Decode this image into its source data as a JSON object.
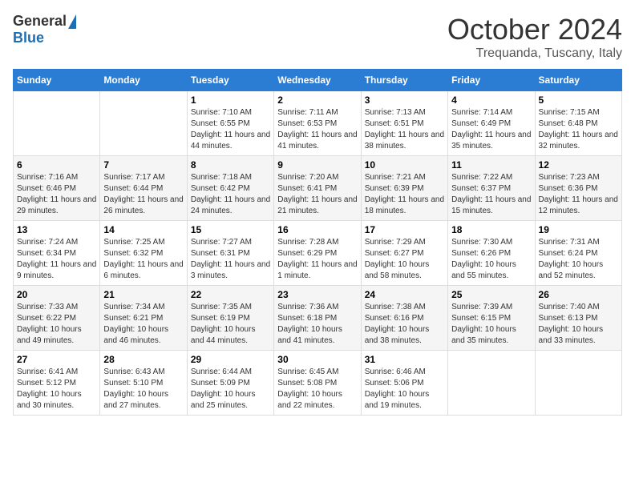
{
  "logo": {
    "general": "General",
    "blue": "Blue"
  },
  "title": "October 2024",
  "location": "Trequanda, Tuscany, Italy",
  "days_of_week": [
    "Sunday",
    "Monday",
    "Tuesday",
    "Wednesday",
    "Thursday",
    "Friday",
    "Saturday"
  ],
  "weeks": [
    [
      {
        "day": "",
        "sunrise": "",
        "sunset": "",
        "daylight": ""
      },
      {
        "day": "",
        "sunrise": "",
        "sunset": "",
        "daylight": ""
      },
      {
        "day": "1",
        "sunrise": "Sunrise: 7:10 AM",
        "sunset": "Sunset: 6:55 PM",
        "daylight": "Daylight: 11 hours and 44 minutes."
      },
      {
        "day": "2",
        "sunrise": "Sunrise: 7:11 AM",
        "sunset": "Sunset: 6:53 PM",
        "daylight": "Daylight: 11 hours and 41 minutes."
      },
      {
        "day": "3",
        "sunrise": "Sunrise: 7:13 AM",
        "sunset": "Sunset: 6:51 PM",
        "daylight": "Daylight: 11 hours and 38 minutes."
      },
      {
        "day": "4",
        "sunrise": "Sunrise: 7:14 AM",
        "sunset": "Sunset: 6:49 PM",
        "daylight": "Daylight: 11 hours and 35 minutes."
      },
      {
        "day": "5",
        "sunrise": "Sunrise: 7:15 AM",
        "sunset": "Sunset: 6:48 PM",
        "daylight": "Daylight: 11 hours and 32 minutes."
      }
    ],
    [
      {
        "day": "6",
        "sunrise": "Sunrise: 7:16 AM",
        "sunset": "Sunset: 6:46 PM",
        "daylight": "Daylight: 11 hours and 29 minutes."
      },
      {
        "day": "7",
        "sunrise": "Sunrise: 7:17 AM",
        "sunset": "Sunset: 6:44 PM",
        "daylight": "Daylight: 11 hours and 26 minutes."
      },
      {
        "day": "8",
        "sunrise": "Sunrise: 7:18 AM",
        "sunset": "Sunset: 6:42 PM",
        "daylight": "Daylight: 11 hours and 24 minutes."
      },
      {
        "day": "9",
        "sunrise": "Sunrise: 7:20 AM",
        "sunset": "Sunset: 6:41 PM",
        "daylight": "Daylight: 11 hours and 21 minutes."
      },
      {
        "day": "10",
        "sunrise": "Sunrise: 7:21 AM",
        "sunset": "Sunset: 6:39 PM",
        "daylight": "Daylight: 11 hours and 18 minutes."
      },
      {
        "day": "11",
        "sunrise": "Sunrise: 7:22 AM",
        "sunset": "Sunset: 6:37 PM",
        "daylight": "Daylight: 11 hours and 15 minutes."
      },
      {
        "day": "12",
        "sunrise": "Sunrise: 7:23 AM",
        "sunset": "Sunset: 6:36 PM",
        "daylight": "Daylight: 11 hours and 12 minutes."
      }
    ],
    [
      {
        "day": "13",
        "sunrise": "Sunrise: 7:24 AM",
        "sunset": "Sunset: 6:34 PM",
        "daylight": "Daylight: 11 hours and 9 minutes."
      },
      {
        "day": "14",
        "sunrise": "Sunrise: 7:25 AM",
        "sunset": "Sunset: 6:32 PM",
        "daylight": "Daylight: 11 hours and 6 minutes."
      },
      {
        "day": "15",
        "sunrise": "Sunrise: 7:27 AM",
        "sunset": "Sunset: 6:31 PM",
        "daylight": "Daylight: 11 hours and 3 minutes."
      },
      {
        "day": "16",
        "sunrise": "Sunrise: 7:28 AM",
        "sunset": "Sunset: 6:29 PM",
        "daylight": "Daylight: 11 hours and 1 minute."
      },
      {
        "day": "17",
        "sunrise": "Sunrise: 7:29 AM",
        "sunset": "Sunset: 6:27 PM",
        "daylight": "Daylight: 10 hours and 58 minutes."
      },
      {
        "day": "18",
        "sunrise": "Sunrise: 7:30 AM",
        "sunset": "Sunset: 6:26 PM",
        "daylight": "Daylight: 10 hours and 55 minutes."
      },
      {
        "day": "19",
        "sunrise": "Sunrise: 7:31 AM",
        "sunset": "Sunset: 6:24 PM",
        "daylight": "Daylight: 10 hours and 52 minutes."
      }
    ],
    [
      {
        "day": "20",
        "sunrise": "Sunrise: 7:33 AM",
        "sunset": "Sunset: 6:22 PM",
        "daylight": "Daylight: 10 hours and 49 minutes."
      },
      {
        "day": "21",
        "sunrise": "Sunrise: 7:34 AM",
        "sunset": "Sunset: 6:21 PM",
        "daylight": "Daylight: 10 hours and 46 minutes."
      },
      {
        "day": "22",
        "sunrise": "Sunrise: 7:35 AM",
        "sunset": "Sunset: 6:19 PM",
        "daylight": "Daylight: 10 hours and 44 minutes."
      },
      {
        "day": "23",
        "sunrise": "Sunrise: 7:36 AM",
        "sunset": "Sunset: 6:18 PM",
        "daylight": "Daylight: 10 hours and 41 minutes."
      },
      {
        "day": "24",
        "sunrise": "Sunrise: 7:38 AM",
        "sunset": "Sunset: 6:16 PM",
        "daylight": "Daylight: 10 hours and 38 minutes."
      },
      {
        "day": "25",
        "sunrise": "Sunrise: 7:39 AM",
        "sunset": "Sunset: 6:15 PM",
        "daylight": "Daylight: 10 hours and 35 minutes."
      },
      {
        "day": "26",
        "sunrise": "Sunrise: 7:40 AM",
        "sunset": "Sunset: 6:13 PM",
        "daylight": "Daylight: 10 hours and 33 minutes."
      }
    ],
    [
      {
        "day": "27",
        "sunrise": "Sunrise: 6:41 AM",
        "sunset": "Sunset: 5:12 PM",
        "daylight": "Daylight: 10 hours and 30 minutes."
      },
      {
        "day": "28",
        "sunrise": "Sunrise: 6:43 AM",
        "sunset": "Sunset: 5:10 PM",
        "daylight": "Daylight: 10 hours and 27 minutes."
      },
      {
        "day": "29",
        "sunrise": "Sunrise: 6:44 AM",
        "sunset": "Sunset: 5:09 PM",
        "daylight": "Daylight: 10 hours and 25 minutes."
      },
      {
        "day": "30",
        "sunrise": "Sunrise: 6:45 AM",
        "sunset": "Sunset: 5:08 PM",
        "daylight": "Daylight: 10 hours and 22 minutes."
      },
      {
        "day": "31",
        "sunrise": "Sunrise: 6:46 AM",
        "sunset": "Sunset: 5:06 PM",
        "daylight": "Daylight: 10 hours and 19 minutes."
      },
      {
        "day": "",
        "sunrise": "",
        "sunset": "",
        "daylight": ""
      },
      {
        "day": "",
        "sunrise": "",
        "sunset": "",
        "daylight": ""
      }
    ]
  ]
}
